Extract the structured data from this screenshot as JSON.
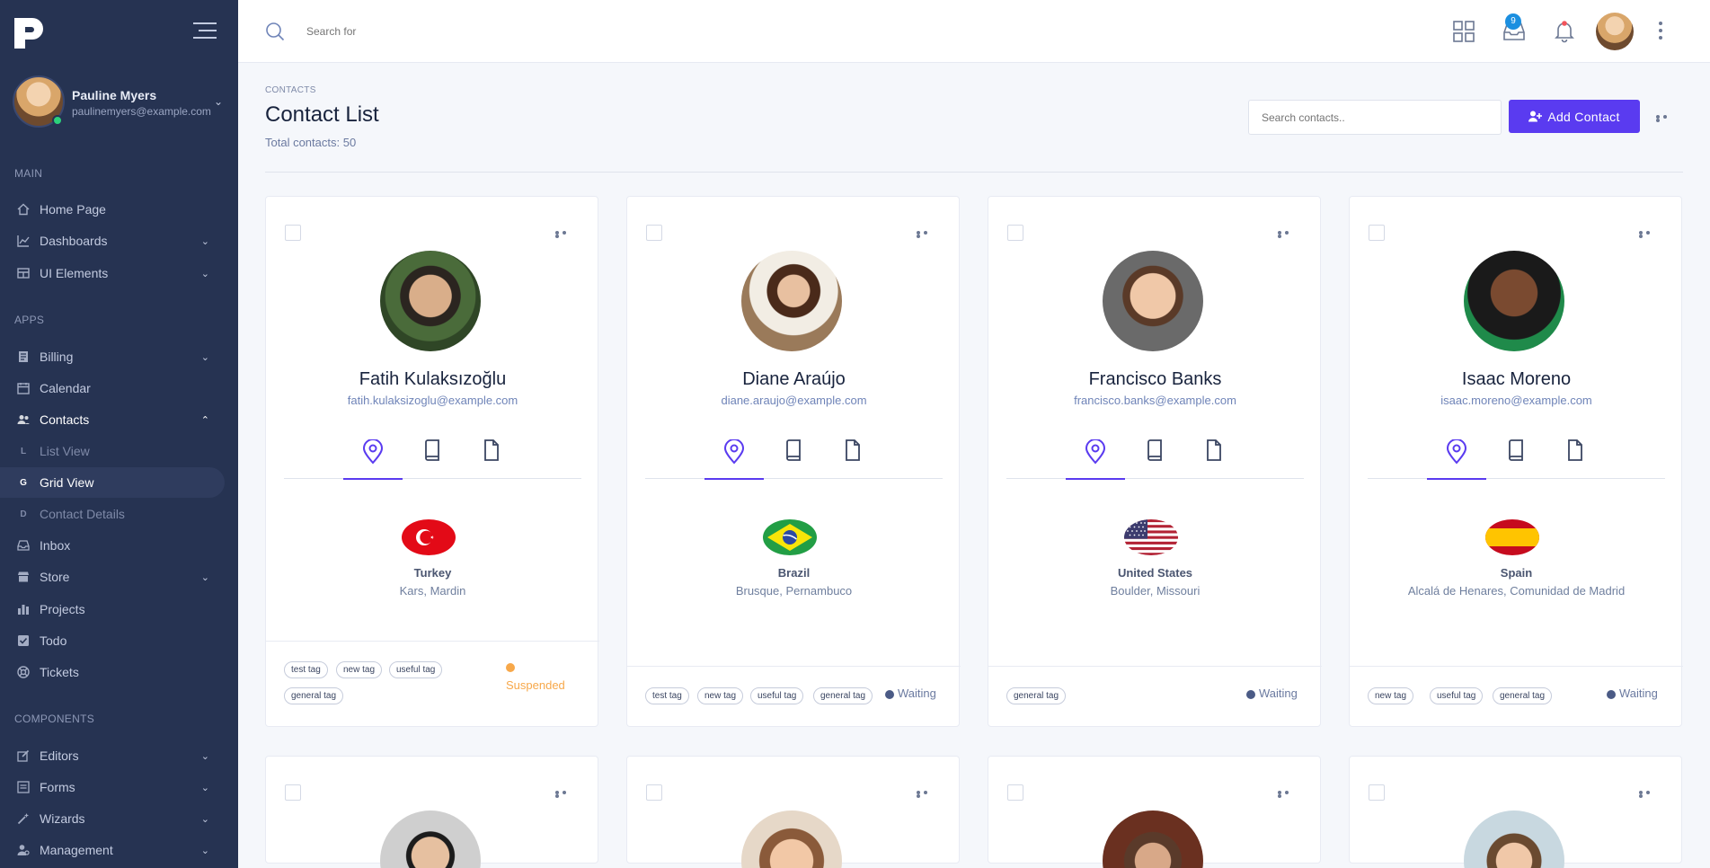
{
  "sidebar": {
    "user": {
      "name": "Pauline Myers",
      "email": "paulinemyers@example.com"
    },
    "sections": {
      "main": "MAIN",
      "apps": "APPS",
      "components": "COMPONENTS"
    },
    "items": {
      "home": "Home Page",
      "dashboards": "Dashboards",
      "ui_elements": "UI Elements",
      "billing": "Billing",
      "calendar": "Calendar",
      "contacts": "Contacts",
      "list_view": "List View",
      "grid_view": "Grid View",
      "contact_details": "Contact Details",
      "inbox": "Inbox",
      "store": "Store",
      "projects": "Projects",
      "todo": "Todo",
      "tickets": "Tickets",
      "editors": "Editors",
      "forms": "Forms",
      "wizards": "Wizards",
      "management": "Management"
    },
    "sub_letters": {
      "list_view": "L",
      "grid_view": "G",
      "contact_details": "D"
    }
  },
  "topbar": {
    "search_placeholder": "Search for",
    "inbox_badge": "9"
  },
  "header": {
    "breadcrumb": "CONTACTS",
    "title": "Contact List",
    "total": "Total contacts: 50",
    "search_placeholder": "Search contacts..",
    "add_button": "Add Contact"
  },
  "cards": [
    {
      "name": "Fatih Kulaksızoğlu",
      "email": "fatih.kulaksizoglu@example.com",
      "country": "Turkey",
      "city": "Kars, Mardin",
      "tags": [
        "test tag",
        "new tag",
        "useful tag",
        "general tag"
      ],
      "status": "Suspended",
      "status_color": "#f7a84a"
    },
    {
      "name": "Diane Araújo",
      "email": "diane.araujo@example.com",
      "country": "Brazil",
      "city": "Brusque, Pernambuco",
      "tags": [
        "test tag",
        "new tag",
        "useful tag",
        "general tag"
      ],
      "status": "Waiting",
      "status_color": "#4b5b86"
    },
    {
      "name": "Francisco Banks",
      "email": "francisco.banks@example.com",
      "country": "United States",
      "city": "Boulder, Missouri",
      "tags": [
        "general tag"
      ],
      "status": "Waiting",
      "status_color": "#4b5b86"
    },
    {
      "name": "Isaac Moreno",
      "email": "isaac.moreno@example.com",
      "country": "Spain",
      "city": "Alcalá de Henares, Comunidad de Madrid",
      "tags": [
        "new tag",
        "useful tag",
        "general tag"
      ],
      "status": "Waiting",
      "status_color": "#4b5b86"
    }
  ],
  "colors": {
    "accent": "#5a3bf0",
    "sidebar": "#263352",
    "badge": "#1b8fe0"
  }
}
